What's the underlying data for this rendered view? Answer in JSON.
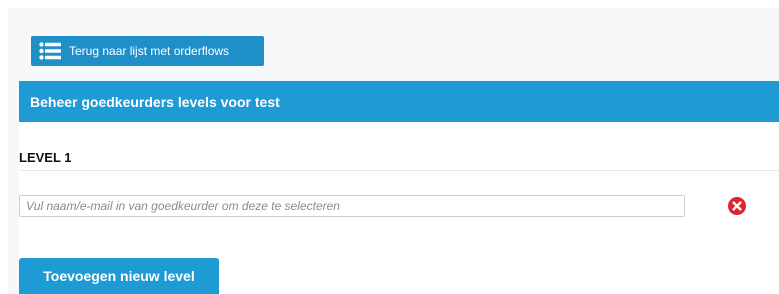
{
  "toolbar": {
    "back_label": "Terug naar lijst met orderflows",
    "back_icon": "list-icon"
  },
  "header": {
    "title": "Beheer goedkeurders levels voor test"
  },
  "levels": [
    {
      "title": "LEVEL 1",
      "input": {
        "value": "",
        "placeholder": "Vul naam/e-mail in van goedkeurder om deze te selecteren"
      },
      "remove_icon": "remove-circle-icon"
    }
  ],
  "actions": {
    "add_level_label": "Toevoegen nieuw level"
  },
  "colors": {
    "accent": "#1e9ad4",
    "button": "#1f8fc8",
    "danger": "#e0242c",
    "panel_bg": "#f7f8fa"
  }
}
